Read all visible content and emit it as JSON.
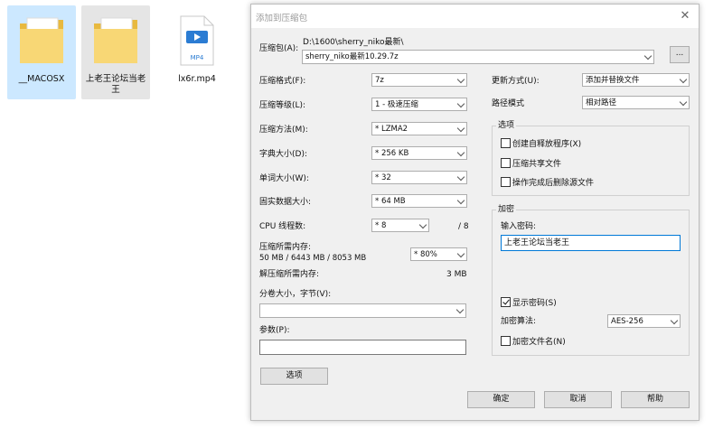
{
  "desktop": {
    "files": [
      {
        "label": "__MACOSX",
        "icon": "folder-icon"
      },
      {
        "label": "上老王论坛当老王",
        "icon": "folder-icon"
      },
      {
        "label": "lx6r.mp4",
        "icon": "video-file-icon",
        "badge": "MP4"
      }
    ]
  },
  "dialog": {
    "title": "添加到压缩包",
    "close": "✕",
    "archive": {
      "label": "压缩包(A):",
      "path": "D:\\1600\\sherry_niko最新\\",
      "filename": "sherry_niko最新10.29.7z",
      "browse_label": "..."
    },
    "format": {
      "label": "压缩格式(F):",
      "value": "7z"
    },
    "level": {
      "label": "压缩等级(L):",
      "value": "1 - 极速压缩"
    },
    "method": {
      "label": "压缩方法(M):",
      "value": "* LZMA2"
    },
    "dict": {
      "label": "字典大小(D):",
      "value": "* 256 KB"
    },
    "word": {
      "label": "单词大小(W):",
      "value": "* 32"
    },
    "solid": {
      "label": "固实数据大小:",
      "value": "* 64 MB"
    },
    "threads": {
      "label": "CPU 线程数:",
      "value": "* 8",
      "max": "/ 8"
    },
    "memory": {
      "compress_label": "压缩所需内存:",
      "compress_value": "50 MB / 6443 MB / 8053 MB",
      "percent": "* 80%",
      "decompress_label": "解压缩所需内存:",
      "decompress_value": "3 MB"
    },
    "volume": {
      "label": "分卷大小，字节(V):",
      "value": ""
    },
    "params": {
      "label": "参数(P):",
      "value": ""
    },
    "options_button": "选项",
    "update": {
      "label": "更新方式(U):",
      "value": "添加并替换文件"
    },
    "path_mode": {
      "label": "路径模式",
      "value": "相对路径"
    },
    "options_group": {
      "title": "选项",
      "items": [
        {
          "label": "创建自释放程序(X)",
          "checked": false
        },
        {
          "label": "压缩共享文件",
          "checked": false
        },
        {
          "label": "操作完成后删除源文件",
          "checked": false
        }
      ]
    },
    "encryption": {
      "title": "加密",
      "password_label": "输入密码:",
      "password_value": "上老王论坛当老王",
      "show_password": {
        "label": "显示密码(S)",
        "checked": true
      },
      "method_label": "加密算法:",
      "method_value": "AES-256",
      "encrypt_names": {
        "label": "加密文件名(N)",
        "checked": false
      }
    },
    "buttons": {
      "ok": "确定",
      "cancel": "取消",
      "help": "帮助"
    }
  }
}
